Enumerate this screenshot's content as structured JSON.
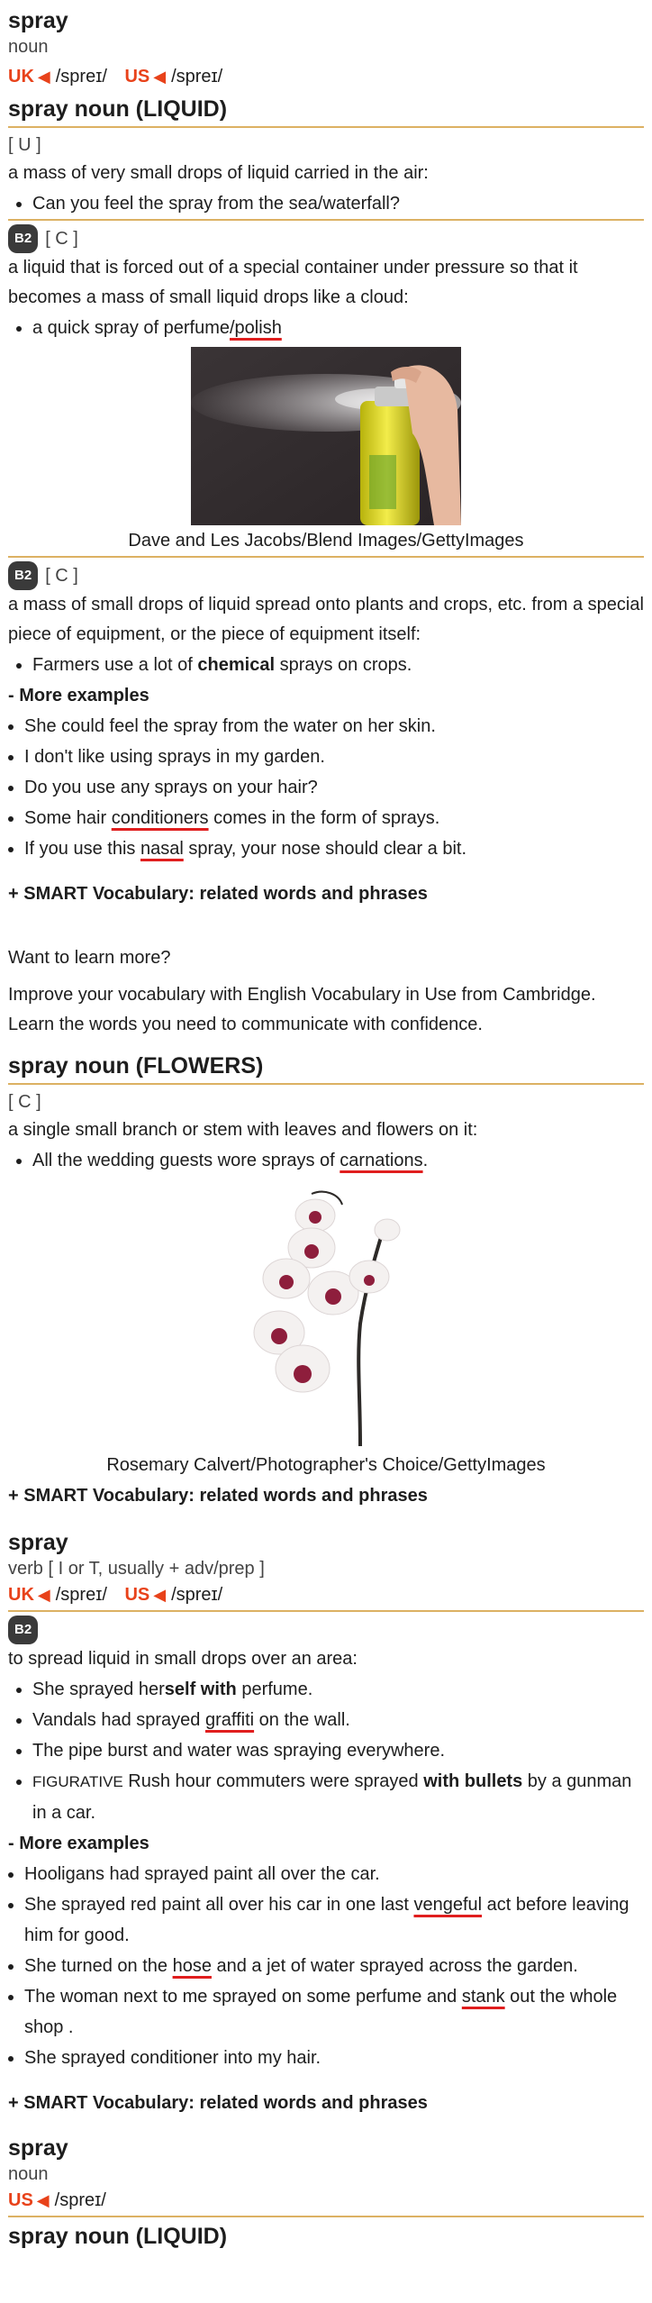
{
  "entry1": {
    "headword": "spray",
    "pos": "noun",
    "uk_label": "UK",
    "uk_ipa": "/spreɪ/",
    "us_label": "US",
    "us_ipa": "/spreɪ/"
  },
  "sense_liquid": {
    "heading": "spray noun (LIQUID)",
    "s1": {
      "grammar": "[ U ]",
      "definition": "a mass of very small drops of liquid carried in the air:",
      "ex1": "Can you feel the spray from the sea/waterfall?"
    },
    "s2": {
      "level": "B2",
      "grammar": "[ C ]",
      "definition": "a liquid that is forced out of a special container under pressure so that it becomes a mass of small liquid drops like a cloud:",
      "ex1_a": "a quick spray of perfume",
      "ex1_b": "/polish",
      "image_caption": "Dave and Les Jacobs/Blend Images/GettyImages"
    },
    "s3": {
      "level": "B2",
      "grammar": "[ C ]",
      "definition": "a mass of small drops of liquid spread onto plants and crops, etc. from a special piece of equipment, or the piece of equipment itself:",
      "ex1_a": "Farmers use a lot of ",
      "ex1_b": "chemical",
      "ex1_c": " sprays on crops."
    },
    "more_examples": "- More examples",
    "more": {
      "m1": "She could feel the spray from the water on her skin.",
      "m2": "I don't like using sprays in my garden.",
      "m3": "Do you use any sprays on your hair?",
      "m4_a": "Some hair ",
      "m4_b": "conditioners",
      "m4_c": " comes in the form of sprays.",
      "m5_a": "If you use this ",
      "m5_b": "nasal",
      "m5_c": " spray, your nose should clear a bit."
    },
    "smart": "+ SMART Vocabulary: related words and phrases"
  },
  "promo": {
    "title": "Want to learn more?",
    "body": "Improve your vocabulary with English Vocabulary in Use from Cambridge. Learn the words you need to communicate with confidence."
  },
  "sense_flowers": {
    "heading": "spray noun (FLOWERS)",
    "grammar": "[ C ]",
    "definition": "a single small branch or stem with leaves and flowers on it:",
    "ex1_a": "All the wedding guests wore sprays of ",
    "ex1_b": "carnations",
    "ex1_c": ".",
    "image_caption": "Rosemary Calvert/Photographer's Choice/GettyImages",
    "smart": "+ SMART Vocabulary: related words and phrases"
  },
  "entry2": {
    "headword": "spray",
    "grammar": "verb [ I or T, usually + adv/prep ]",
    "uk_label": "UK",
    "uk_ipa": "/spreɪ/",
    "us_label": "US",
    "us_ipa": "/spreɪ/",
    "level": "B2",
    "definition": "to spread liquid in small drops over an area:",
    "ex1_a": "She sprayed her",
    "ex1_b": "self with",
    "ex1_c": " perfume.",
    "ex2_a": "Vandals had sprayed ",
    "ex2_b": "graffiti",
    "ex2_c": " on the wall.",
    "ex3": "The pipe burst and water was spraying everywhere.",
    "ex4_a": "FIGURATIVE",
    "ex4_b": " Rush hour commuters were sprayed ",
    "ex4_c": "with bullets",
    "ex4_d": " by a gunman in a car.",
    "more_examples": "- More examples",
    "m1": "Hooligans had sprayed paint all over the car.",
    "m2_a": "She sprayed red paint all over his car in one last ",
    "m2_b": "vengeful",
    "m2_c": " act before leaving him for good.",
    "m3_a": "She turned on the ",
    "m3_b": "hose",
    "m3_c": " and a jet of water sprayed across the garden.",
    "m4_a": "The woman next to me sprayed on some perfume and ",
    "m4_b": "stank",
    "m4_c": " out the whole shop .",
    "m5": "She sprayed conditioner into my hair.",
    "smart": "+ SMART Vocabulary: related words and phrases"
  },
  "entry3": {
    "headword": "spray",
    "pos": "noun",
    "us_label": "US",
    "us_ipa": "/spreɪ/",
    "sense_heading": "spray noun (LIQUID)"
  },
  "colors": {
    "accent_orange": "#e8421a",
    "divider_gold": "#dcb163",
    "level_badge": "#3a3a3a",
    "annotation_red": "#e01e1e"
  },
  "icons": {
    "speaker": "speaker-icon"
  }
}
